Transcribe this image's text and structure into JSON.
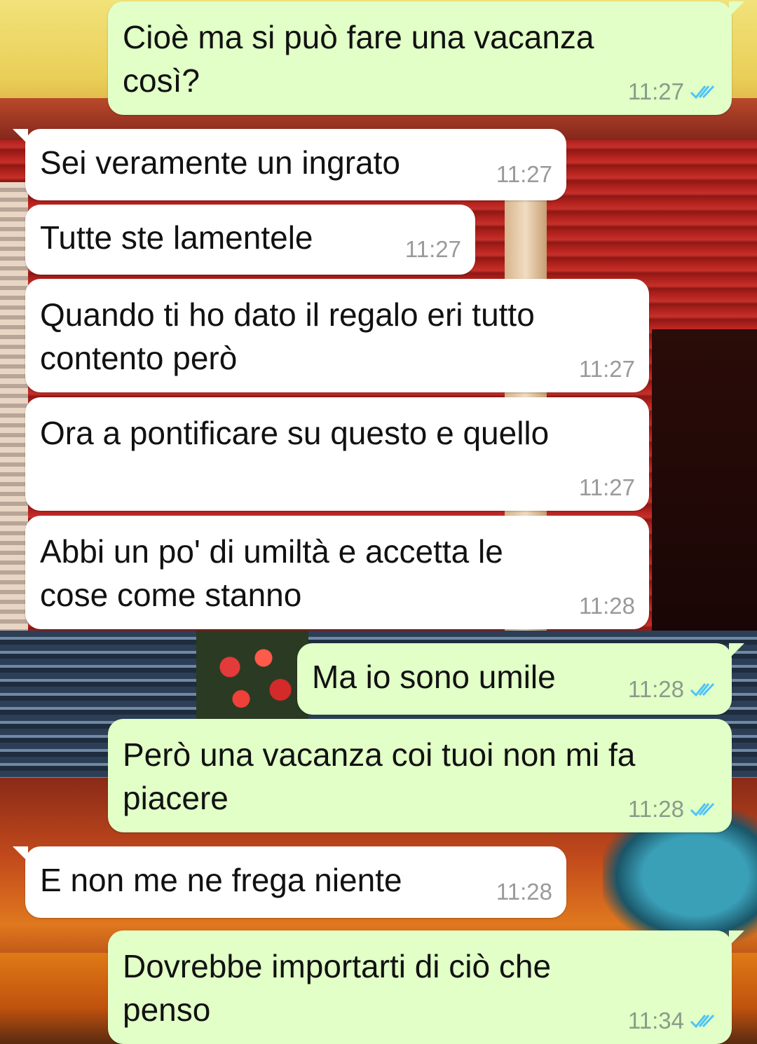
{
  "chat": {
    "messages": [
      {
        "direction": "out",
        "text": "Cioè ma si può fare una vacanza\ncosì?",
        "time": "11:27",
        "read": true
      },
      {
        "direction": "in",
        "text": "Sei veramente un ingrato",
        "time": "11:27"
      },
      {
        "direction": "in",
        "text": "Tutte ste lamentele",
        "time": "11:27"
      },
      {
        "direction": "in",
        "text": "Quando ti ho dato il regalo eri tutto\ncontento però",
        "time": "11:27"
      },
      {
        "direction": "in",
        "text": "Ora a pontificare su questo e quello",
        "time": "11:27"
      },
      {
        "direction": "in",
        "text": "Abbi un po' di umiltà e accetta le\ncose come stanno",
        "time": "11:28"
      },
      {
        "direction": "out",
        "text": "Ma io sono umile",
        "time": "11:28",
        "read": true
      },
      {
        "direction": "out",
        "text": "Però una vacanza coi tuoi non mi fa\npiacere",
        "time": "11:28",
        "read": true
      },
      {
        "direction": "in",
        "text": "E non me ne frega niente",
        "time": "11:28"
      },
      {
        "direction": "out",
        "text": "Dovrebbe importarti di ciò che\npenso",
        "time": "11:34",
        "read": true
      }
    ]
  },
  "colors": {
    "outgoing_bubble": "#e1ffc7",
    "incoming_bubble": "#ffffff",
    "read_ticks": "#4fc3f7"
  },
  "icons": {
    "read_receipt": "double-check-icon"
  }
}
